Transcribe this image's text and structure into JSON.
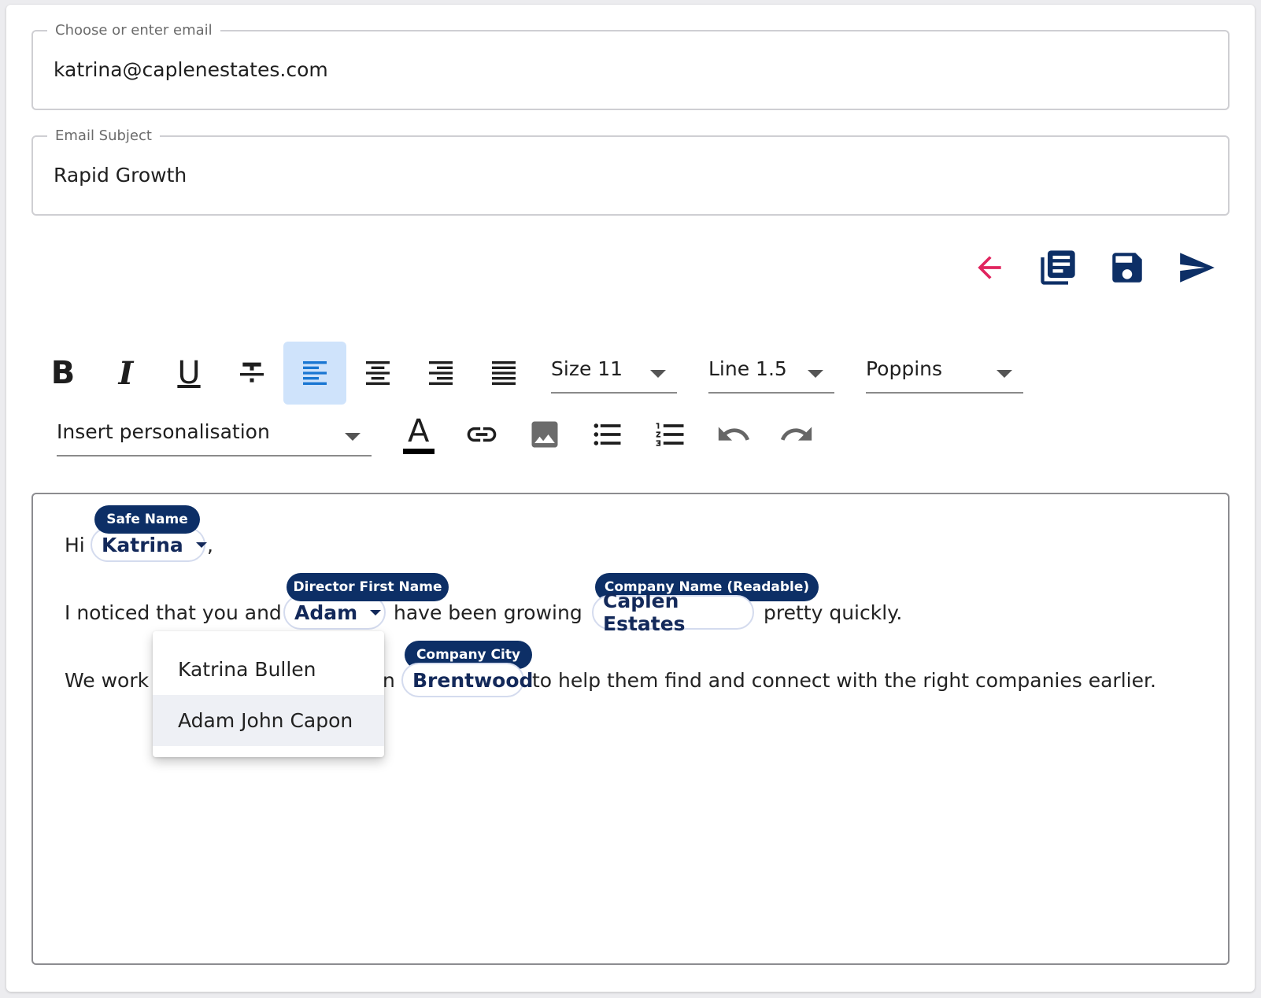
{
  "email_field": {
    "legend": "Choose or enter email",
    "value": "katrina@caplenestates.com"
  },
  "subject_field": {
    "legend": "Email Subject",
    "value": "Rapid Growth"
  },
  "colors": {
    "accent_red": "#e0245e",
    "navy": "#0d2f66",
    "active_bg": "#cfe3fb"
  },
  "actions": [
    "back-arrow-icon",
    "template-icon",
    "save-icon",
    "send-icon"
  ],
  "toolbar": {
    "bold": "B",
    "italic": "I",
    "underline": "U",
    "size_label": "Size 11",
    "line_label": "Line 1.5",
    "font_label": "Poppins",
    "personalisation_label": "Insert personalisation",
    "text_color_letter": "A"
  },
  "body": {
    "line1": {
      "prefix": "Hi",
      "chip": "Katrina",
      "tag": "Safe Name",
      "suffix": ","
    },
    "line2": {
      "prefix": "I noticed that you and",
      "chip1": "Adam",
      "tag1": "Director First Name",
      "middle": "have been growing",
      "chip2": "Caplen Estates",
      "tag2": "Company Name (Readable)",
      "suffix": "pretty quickly."
    },
    "line3": {
      "prefix": "We work",
      "partial": "n",
      "chip": "Brentwood",
      "tag": "Company City",
      "suffix": "to help them find and connect with the right companies earlier."
    }
  },
  "dropdown": {
    "items": [
      "Katrina Bullen",
      "Adam John Capon"
    ],
    "highlighted_index": 1
  }
}
